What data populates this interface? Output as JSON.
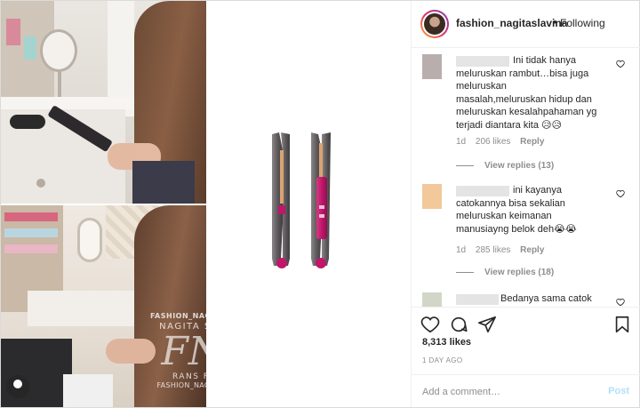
{
  "header": {
    "username": "fashion_nagitaslavina",
    "separator": "•",
    "follow_status": "Following"
  },
  "watermark": {
    "line1": "FASHION_NAGITASLAVINA",
    "line2": "NAGITA SLAVINA",
    "monogram": "FNS",
    "line3": "RANS FAMILY",
    "line4": "FASHION_NAGITASLAVINA"
  },
  "comments": [
    {
      "text": "Ini tidak hanya meluruskan rambut…bisa juga meluruskan masalah,meluruskan hidup dan meluruskan kesalahpahaman yg terjadi diantara kita 😥😥",
      "time": "1d",
      "likes": "206 likes",
      "reply": "Reply",
      "view_replies": "View replies (13)",
      "avatar_color": "#b8aeae"
    },
    {
      "text": "ini kayanya catokannya bisa sekalian meluruskan keimanan manusiayng belok deh😭😭",
      "time": "1d",
      "likes": "285 likes",
      "reply": "Reply",
      "view_replies": "View replies (18)",
      "avatar_color": "#f2c99a"
    },
    {
      "text": "Bedanya sama catok",
      "avatar_color": "#d2d6c9"
    }
  ],
  "actions": {
    "like_icon": "heart-icon",
    "comment_icon": "comment-icon",
    "share_icon": "send-icon",
    "save_icon": "bookmark-icon"
  },
  "likes_count": "8,313 likes",
  "time_ago": "1 DAY AGO",
  "add_comment": {
    "placeholder": "Add a comment…",
    "post_label": "Post"
  },
  "colors": {
    "accent": "#b2dffc",
    "product_magenta": "#c0176b",
    "product_gray": "#5e5a5d"
  }
}
